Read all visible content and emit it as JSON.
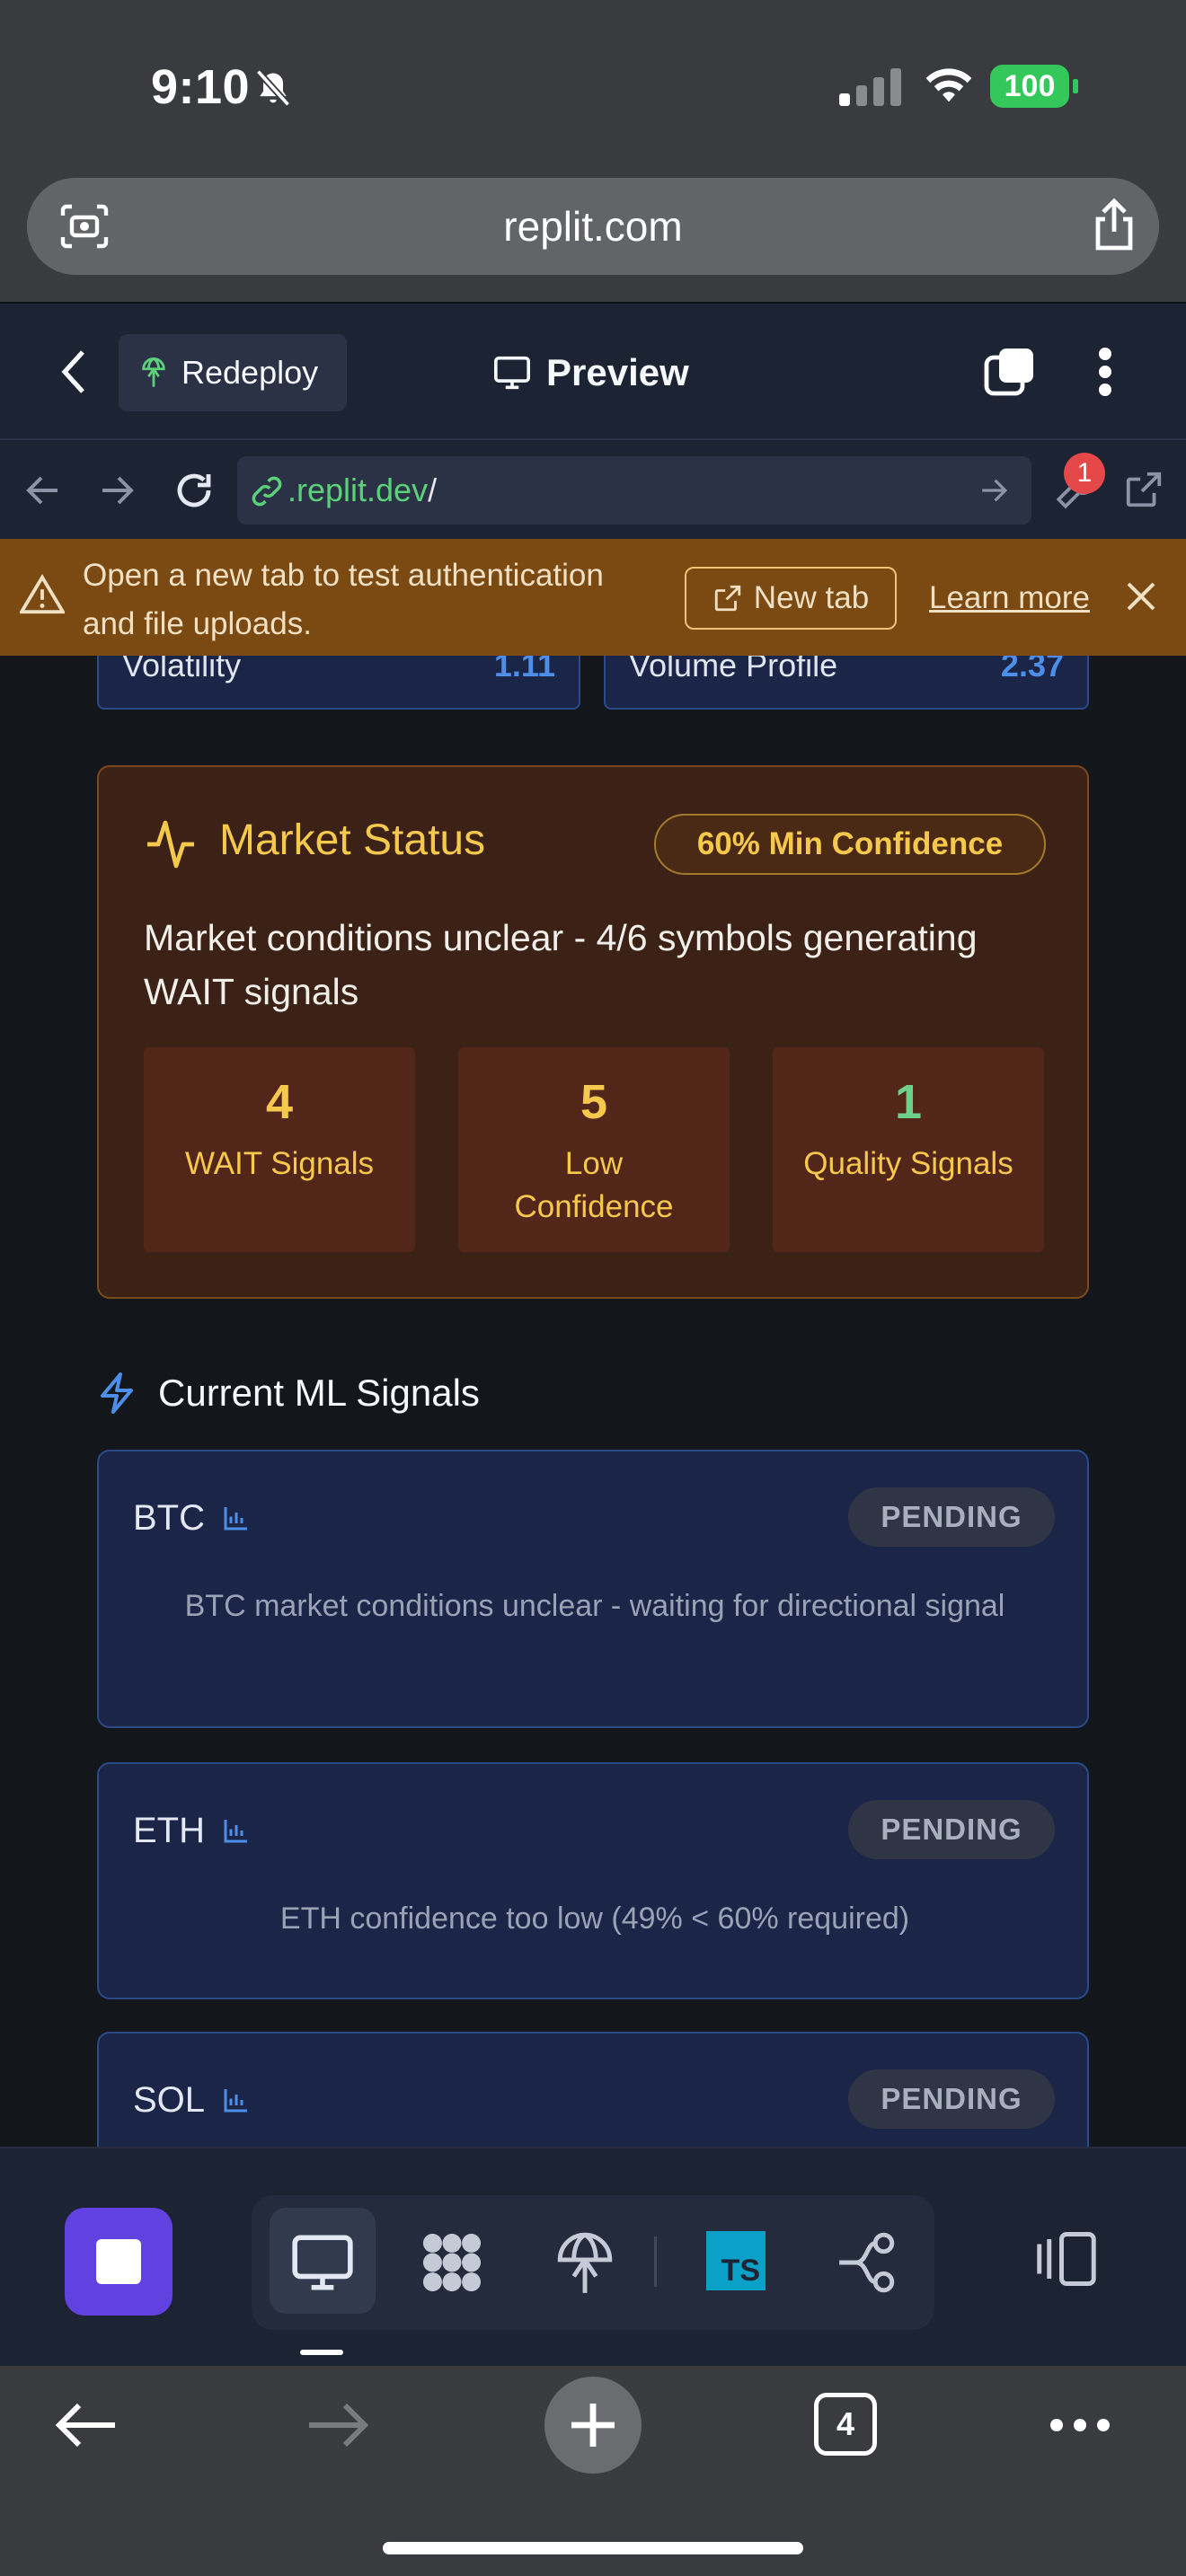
{
  "status_bar": {
    "time": "9:10",
    "battery": "100"
  },
  "safari": {
    "url": "replit.com",
    "tab_count": "4"
  },
  "replit_header": {
    "redeploy_label": "Redeploy",
    "preview_label": "Preview"
  },
  "preview_url": {
    "domain": ".replit.dev",
    "path": "/",
    "notification_count": "1"
  },
  "banner": {
    "message": "Open a new tab to test authentication and file uploads.",
    "new_tab_label": "New tab",
    "learn_more_label": "Learn more"
  },
  "metrics_partial": [
    {
      "label": "Volatility",
      "value": "1.11"
    },
    {
      "label": "Volume Profile",
      "value": "2.37"
    }
  ],
  "market_status": {
    "title": "Market Status",
    "confidence_badge": "60% Min Confidence",
    "description": "Market conditions unclear - 4/6 symbols generating WAIT signals",
    "stats": [
      {
        "value": "4",
        "label": "WAIT Signals",
        "color": "#f6c84c"
      },
      {
        "value": "5",
        "label": "Low Confidence",
        "color": "#f6c84c"
      },
      {
        "value": "1",
        "label": "Quality Signals",
        "color": "#6fd08c"
      }
    ]
  },
  "ml_signals": {
    "title": "Current ML Signals",
    "items": [
      {
        "symbol": "BTC",
        "status": "PENDING",
        "description": "BTC market conditions unclear - waiting for directional signal"
      },
      {
        "symbol": "ETH",
        "status": "PENDING",
        "description": "ETH confidence too low (49% < 60% required)"
      },
      {
        "symbol": "SOL",
        "status": "PENDING",
        "description": ""
      }
    ]
  },
  "colors": {
    "accent": "#f6c84c",
    "brand_stop": "#6142e0",
    "link_green": "#5bd17a"
  }
}
